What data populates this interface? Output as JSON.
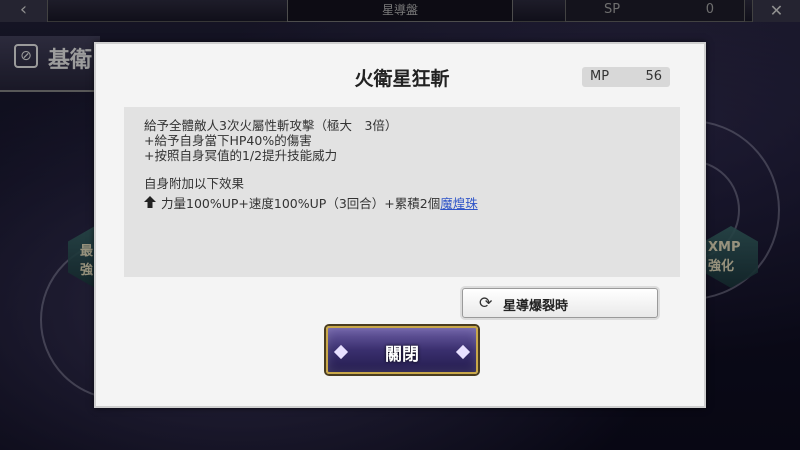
{
  "background": {
    "top_title": "星導盤",
    "sp_label": "SP",
    "sp_value": "0",
    "skill_header": "基衛",
    "hex_left": "最\n強",
    "hex_right": "XMP\n強化"
  },
  "dialog": {
    "title": "火衛星狂斬",
    "mp_label": "MP",
    "mp_value": "56",
    "description": [
      "給予全體敵人3次火屬性斬攻擊（極大　3倍）",
      "+給予自身當下HP40%的傷害",
      "+按照自身冥值的1/2提升技能威力"
    ],
    "self_effect_heading": "自身附加以下效果",
    "effect_text": "力量100%UP+速度100%UP（3回合）+累積2個",
    "effect_link": "魔煌珠",
    "refresh_button_label": "星導爆裂時",
    "close_button_label": "關閉"
  }
}
